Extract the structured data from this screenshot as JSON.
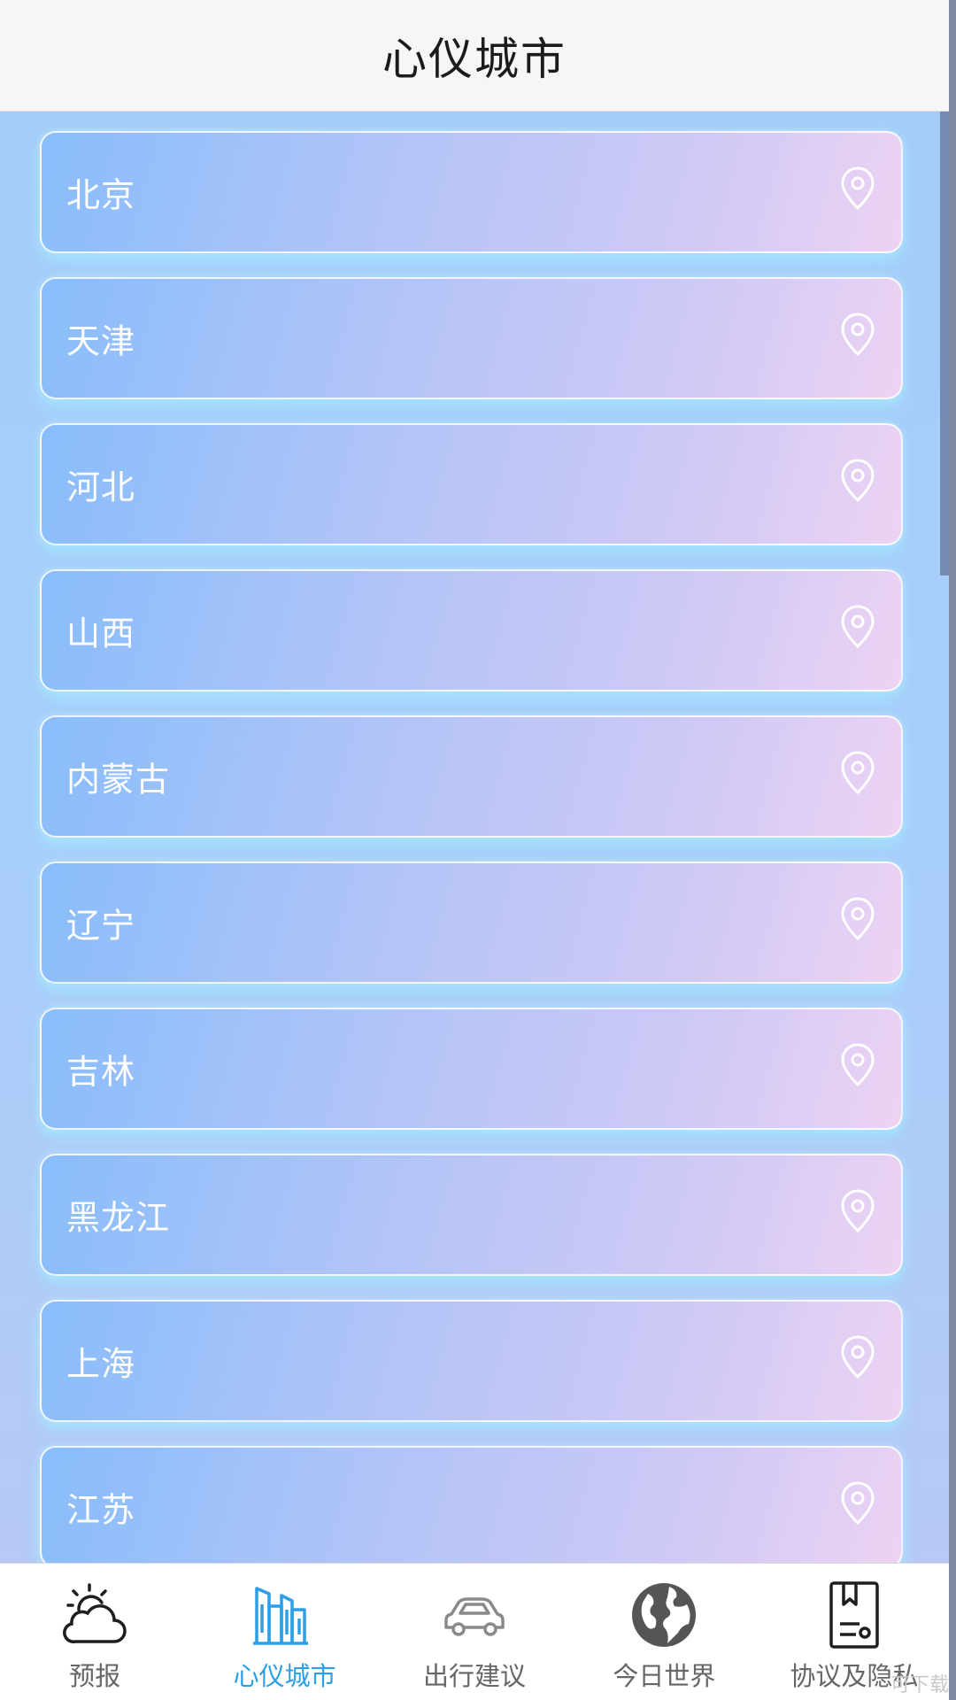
{
  "header": {
    "title": "心仪城市"
  },
  "cities": [
    {
      "name": "北京"
    },
    {
      "name": "天津"
    },
    {
      "name": "河北"
    },
    {
      "name": "山西"
    },
    {
      "name": "内蒙古"
    },
    {
      "name": "辽宁"
    },
    {
      "name": "吉林"
    },
    {
      "name": "黑龙江"
    },
    {
      "name": "上海"
    },
    {
      "name": "江苏"
    }
  ],
  "tabs": [
    {
      "label": "预报",
      "icon": "weather-cloud-sun-icon",
      "active": false
    },
    {
      "label": "心仪城市",
      "icon": "city-buildings-icon",
      "active": true
    },
    {
      "label": "出行建议",
      "icon": "car-icon",
      "active": false
    },
    {
      "label": "今日世界",
      "icon": "globe-icon",
      "active": false
    },
    {
      "label": "协议及隐私",
      "icon": "document-bookmark-icon",
      "active": false
    }
  ],
  "watermark": "可下载",
  "colors": {
    "active_tab": "#2c9fe6",
    "inactive_tab": "#666666",
    "card_gradient_start": "#88bdfb",
    "card_gradient_end": "#edd3f3"
  }
}
